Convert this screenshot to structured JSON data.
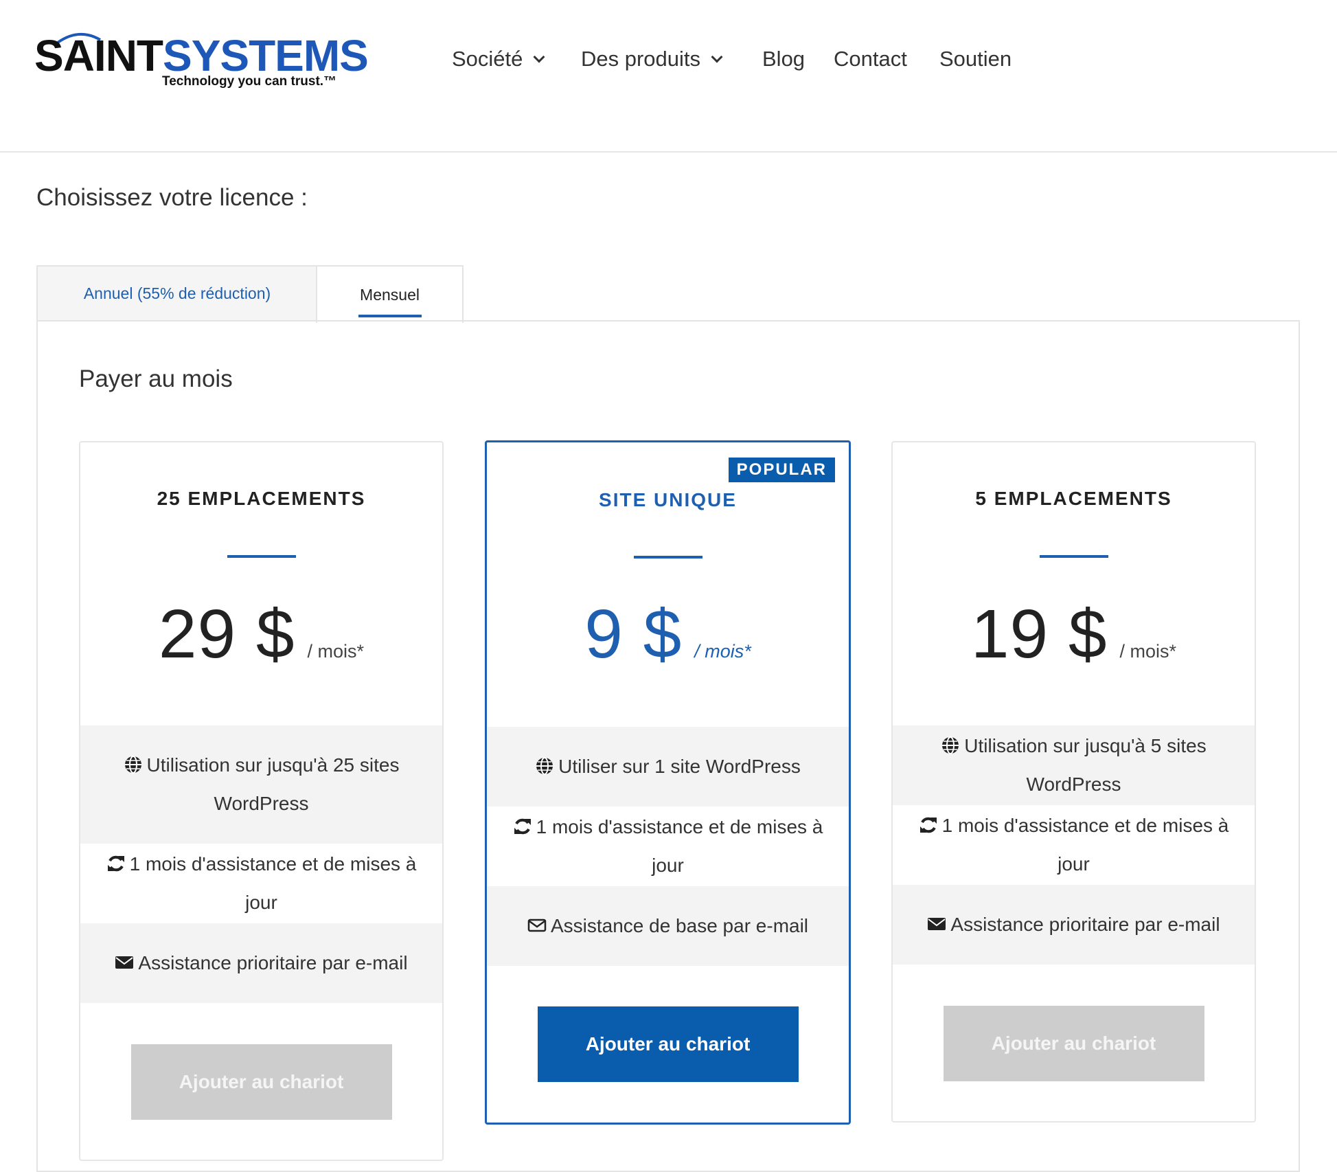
{
  "brand": {
    "name_part1": "SAINT",
    "name_part2": "SYSTEMS",
    "tagline": "Technology you can trust.™"
  },
  "nav": {
    "items": [
      {
        "label": "Société",
        "has_dropdown": true
      },
      {
        "label": "Des produits",
        "has_dropdown": true
      },
      {
        "label": "Blog",
        "has_dropdown": false
      },
      {
        "label": "Contact",
        "has_dropdown": false
      },
      {
        "label": "Soutien",
        "has_dropdown": false
      }
    ]
  },
  "page": {
    "title": "Choisissez votre licence :"
  },
  "tabs": {
    "annual": "Annuel (55% de réduction)",
    "monthly": "Mensuel",
    "active": "monthly"
  },
  "panel": {
    "title": "Payer au mois"
  },
  "cards": [
    {
      "title": "25 EMPLACEMENTS",
      "price": "29 $",
      "per": "/ mois*",
      "features": [
        {
          "icon": "globe-icon",
          "text": "Utilisation sur jusqu'à 25 sites WordPress"
        },
        {
          "icon": "refresh-icon",
          "text": "1 mois d'assistance et de mises à jour"
        },
        {
          "icon": "envelope-icon",
          "text": "Assistance prioritaire par e-mail"
        }
      ],
      "button": "Ajouter au chariot",
      "button_state": "disabled"
    },
    {
      "title": "SITE UNIQUE",
      "badge": "POPULAR",
      "price": "9 $",
      "per": "/ mois*",
      "features": [
        {
          "icon": "globe-icon",
          "text": "Utiliser sur 1 site WordPress"
        },
        {
          "icon": "refresh-icon",
          "text": "1 mois d'assistance et de mises à jour"
        },
        {
          "icon": "envelope-outline-icon",
          "text": "Assistance de base par e-mail"
        }
      ],
      "button": "Ajouter au chariot",
      "button_state": "active"
    },
    {
      "title": "5 EMPLACEMENTS",
      "price": "19 $",
      "per": "/ mois*",
      "features": [
        {
          "icon": "globe-icon",
          "text": "Utilisation sur jusqu'à 5 sites WordPress"
        },
        {
          "icon": "refresh-icon",
          "text": "1 mois d'assistance et de mises à jour"
        },
        {
          "icon": "envelope-icon",
          "text": "Assistance prioritaire par e-mail"
        }
      ],
      "button": "Ajouter au chariot",
      "button_state": "disabled"
    }
  ],
  "colors": {
    "accent": "#0a5cad",
    "link": "#1e5fb0",
    "disabled_button": "#cdcdcd",
    "feature_alt_bg": "#f3f3f3"
  }
}
